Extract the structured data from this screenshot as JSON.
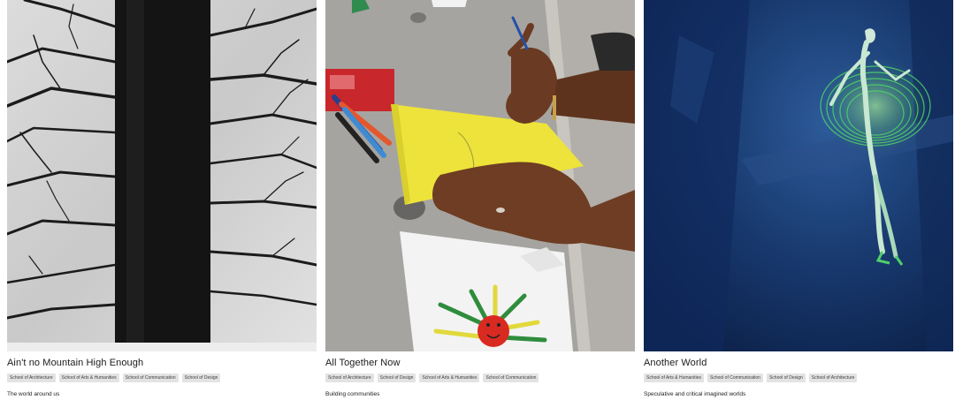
{
  "projects": [
    {
      "title": "Ain't no Mountain High Enough",
      "tags": [
        "School of Architecture",
        "School of Arts & Humanities",
        "School of Communication",
        "School of Design"
      ],
      "description": "The world around us"
    },
    {
      "title": "All Together Now",
      "tags": [
        "School of Architecture",
        "School of Design",
        "School of Arts & Humanities",
        "School of Communication"
      ],
      "description": "Building communities"
    },
    {
      "title": "Another World",
      "tags": [
        "School of Arts & Humanities",
        "School of Communication",
        "School of Design",
        "School of Architecture"
      ],
      "description": "Speculative and critical imagined worlds"
    }
  ],
  "colors": {
    "tag_background": "#e3e3e3",
    "title_text": "#1a1a1a",
    "page_background": "#ffffff"
  }
}
